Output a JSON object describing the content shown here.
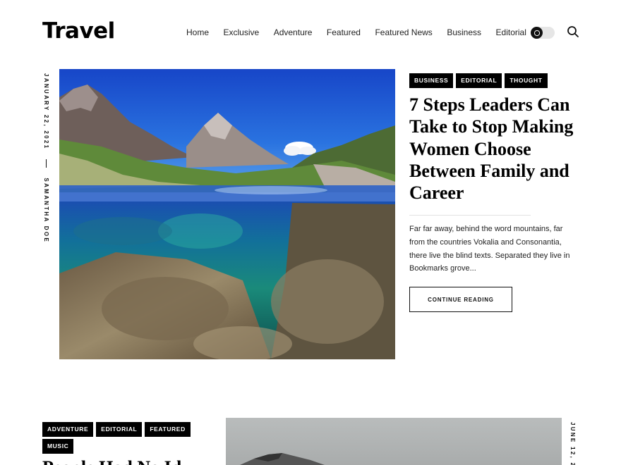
{
  "site": {
    "logo": "Travel"
  },
  "nav": {
    "items": [
      "Home",
      "Exclusive",
      "Adventure",
      "Featured",
      "Featured News",
      "Business",
      "Editorial"
    ]
  },
  "icons": {
    "theme_toggle": "moon-icon",
    "search": "search-icon"
  },
  "posts": [
    {
      "date": "JANUARY 22, 2021",
      "author": "SAMANTHA DOE",
      "tags": [
        "BUSINESS",
        "EDITORIAL",
        "THOUGHT"
      ],
      "title": "7 Steps Leaders Can Take to Stop Making Women Choose Between Family and Career",
      "excerpt": "Far far away, behind the word mountains, far from the countries Vokalia and Consonantia, there live the blind texts. Separated they live in Bookmarks grove...",
      "button": "CONTINUE READING"
    },
    {
      "date": "JUNE 12, 2",
      "tags": [
        "ADVENTURE",
        "EDITORIAL",
        "FEATURED",
        "MUSIC"
      ],
      "title": "People Had No Id"
    }
  ],
  "colors": {
    "text": "#111111",
    "tag_bg": "#000000",
    "tag_text": "#ffffff"
  }
}
